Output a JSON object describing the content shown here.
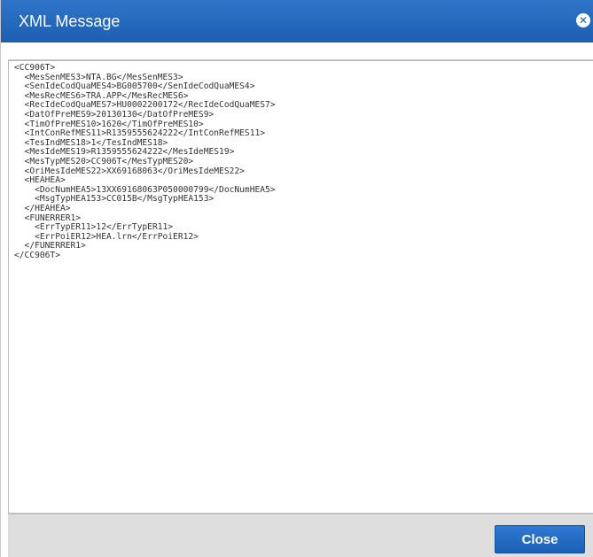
{
  "dialog": {
    "title": "XML Message",
    "close_icon": "close-icon",
    "close_glyph": "✕",
    "xml_content": "<CC906T>\n  <MesSenMES3>NTA.BG</MesSenMES3>\n  <SenIdeCodQuaMES4>BG005700</SenIdeCodQuaMES4>\n  <MesRecMES6>TRA.APP</MesRecMES6>\n  <RecIdeCodQuaMES7>HU0002200172</RecIdeCodQuaMES7>\n  <DatOfPreMES9>20130130</DatOfPreMES9>\n  <TimOfPreMES10>1620</TimOfPreMES10>\n  <IntConRefMES11>R1359555624222</IntConRefMES11>\n  <TesIndMES18>1</TesIndMES18>\n  <MesIdeMES19>R1359555624222</MesIdeMES19>\n  <MesTypMES20>CC906T</MesTypMES20>\n  <OriMesIdeMES22>XX69168063</OriMesIdeMES22>\n  <HEAHEA>\n    <DocNumHEA5>13XX69168063P050000799</DocNumHEA5>\n    <MsgTypHEA153>CC015B</MsgTypHEA153>\n  </HEAHEA>\n  <FUNERRER1>\n    <ErrTypER11>12</ErrTypER11>\n    <ErrPoiER12>HEA.lrn</ErrPoiER12>\n  </FUNERRER1>\n</CC906T>",
    "close_button_label": "Close"
  },
  "colors": {
    "titlebar": "#1d5fb2",
    "button": "#1a5fb6",
    "footer": "#dedede"
  }
}
